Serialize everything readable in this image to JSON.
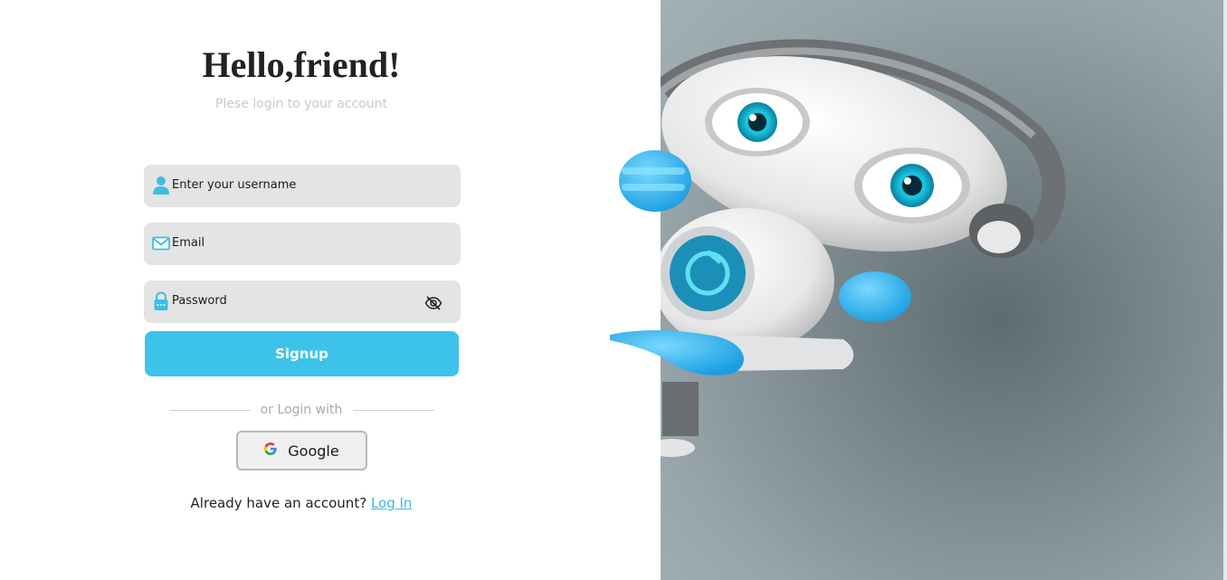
{
  "header": {
    "title": "Hello,friend!",
    "subtitle": "Plese login to your account"
  },
  "form": {
    "username": {
      "placeholder": "Enter your username",
      "icon": "user-icon"
    },
    "email": {
      "placeholder": "Email",
      "icon": "mail-icon"
    },
    "password": {
      "placeholder": "Password",
      "icon": "lock-icon",
      "toggle_icon": "eye-slash-icon"
    },
    "signup_label": "Signup"
  },
  "social": {
    "divider_text": "or Login with",
    "google_label": "Google",
    "google_icon": "google-icon"
  },
  "footer": {
    "prompt": "Already have an account?",
    "login_link": "Log In"
  },
  "colors": {
    "accent": "#3dc3ea",
    "field_bg": "#e4e4e4",
    "link": "#3db5df",
    "illustration_bg": "#8e9ca2"
  },
  "illustration": {
    "subject": "robot-peeking-illustration"
  }
}
